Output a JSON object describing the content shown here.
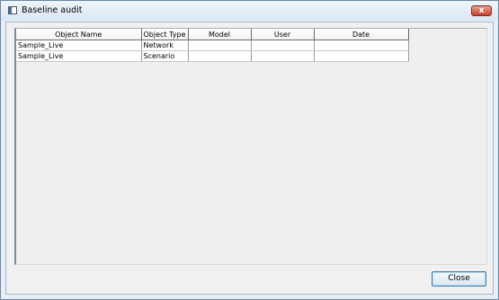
{
  "window": {
    "title": "Baseline audit",
    "close_glyph": "x"
  },
  "table": {
    "columns": [
      "Object Name",
      "Object Type",
      "Model",
      "User",
      "Date"
    ],
    "rows": [
      [
        "Sample_Live",
        "Network",
        "",
        "",
        ""
      ],
      [
        "Sample_Live",
        "Scenario",
        "",
        "",
        ""
      ]
    ]
  },
  "buttons": {
    "close_label": "Close"
  }
}
